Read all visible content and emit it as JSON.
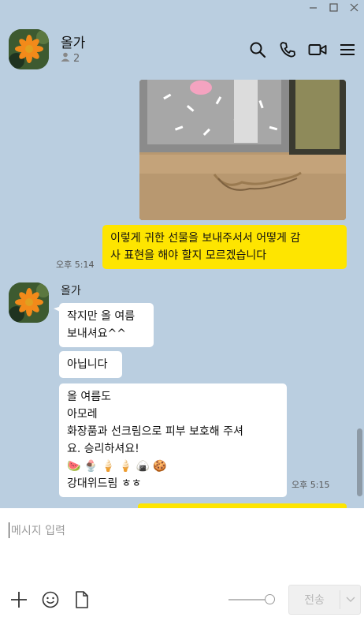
{
  "window": {
    "min_icon": "minimize-icon",
    "max_icon": "maximize-icon",
    "close_icon": "close-icon"
  },
  "header": {
    "name": "올가",
    "member_count": "2",
    "icons": [
      "search-icon",
      "phone-icon",
      "video-call-icon",
      "menu-icon"
    ]
  },
  "messages": {
    "m1": {
      "text": "이렇게 귀한 선물을 보내주서서 어떻게 감\n사 표현을 해야 할지 모르겠습니다",
      "time": "오후 5:14"
    },
    "sender": "올가",
    "m2": {
      "text": "작지만 올 여름\n보내셔요^^"
    },
    "m3": {
      "text": "아닙니다"
    },
    "m4": {
      "text": "올 여름도\n아모레\n화장품과 선크림으로 피부 보호해 주셔\n요. 승리하셔요!\n🍉 🍨 🍦 🍦 🍙 🍪\n강대위드림 ㅎㅎ",
      "time": "오후 5:15"
    }
  },
  "input": {
    "placeholder": "메시지 입력"
  },
  "toolbar": {
    "send_label": "전송"
  },
  "colors": {
    "background": "#bacee0",
    "my_bubble": "#fee500",
    "other_bubble": "#ffffff"
  }
}
